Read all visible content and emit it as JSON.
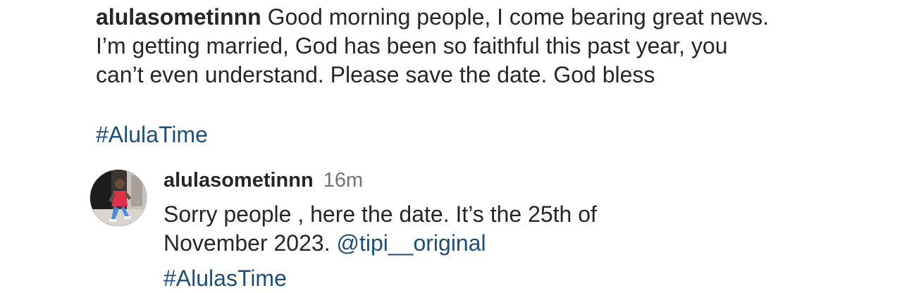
{
  "post": {
    "username": "alulasometinnn",
    "caption": "Good morning people, I come bearing great news. I’m getting married, God has been so faithful this past year, you can’t even understand. Please save the date. God bless",
    "hashtag": "#AlulaTime"
  },
  "comment": {
    "avatar_icon": "profile-photo-avatar",
    "username": "alulasometinnn",
    "time": "16m",
    "text": "Sorry people , here the date. It’s the 25th of November 2023.",
    "mention": "@tipi__original",
    "hashtag": "#AlulasTime"
  },
  "colors": {
    "text": "#262626",
    "secondary_text": "#737373",
    "link": "#1f4e79",
    "background": "#ffffff"
  }
}
